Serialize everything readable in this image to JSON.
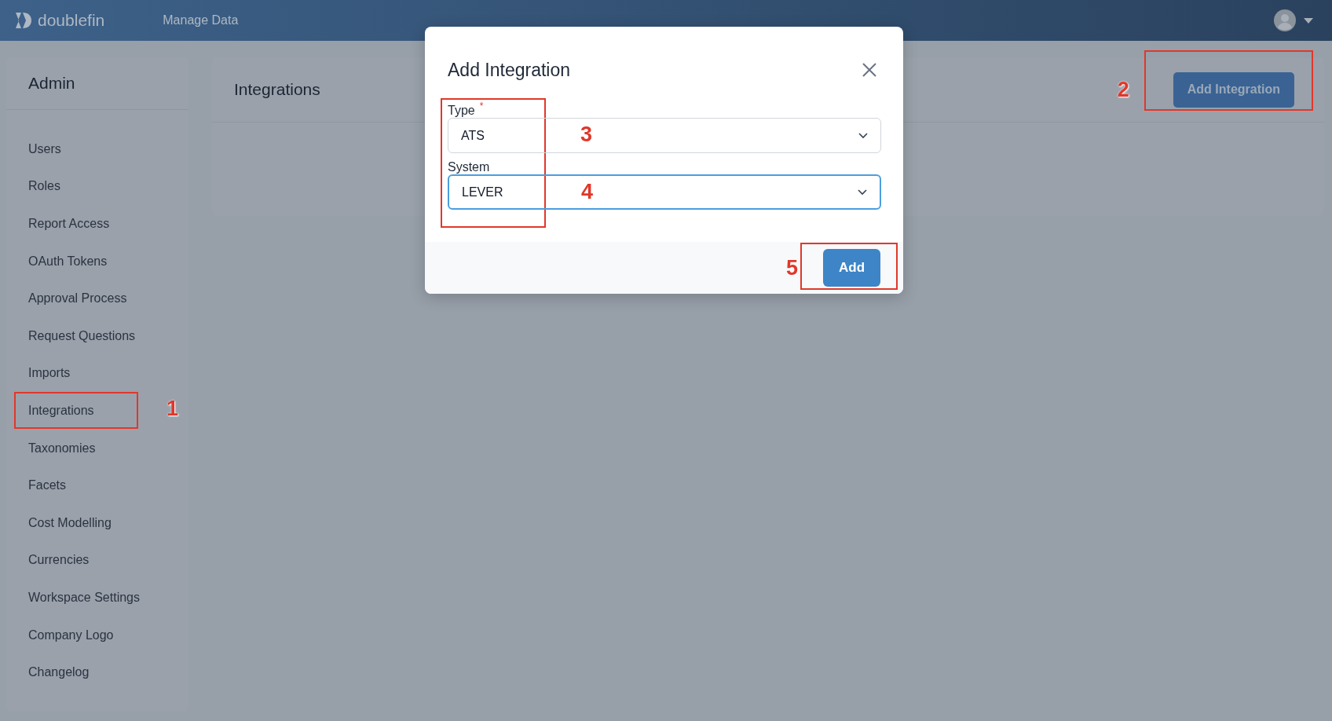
{
  "header": {
    "logo_text": "doublefin",
    "nav": "Manage Data"
  },
  "sidebar": {
    "title": "Admin",
    "items": [
      {
        "label": "Users"
      },
      {
        "label": "Roles"
      },
      {
        "label": "Report Access"
      },
      {
        "label": "OAuth Tokens"
      },
      {
        "label": "Approval Process"
      },
      {
        "label": "Request Questions"
      },
      {
        "label": "Imports"
      },
      {
        "label": "Integrations",
        "callout": "1"
      },
      {
        "label": "Taxonomies"
      },
      {
        "label": "Facets"
      },
      {
        "label": "Cost Modelling"
      },
      {
        "label": "Currencies"
      },
      {
        "label": "Workspace Settings"
      },
      {
        "label": "Company Logo"
      },
      {
        "label": "Changelog"
      }
    ]
  },
  "main": {
    "title": "Integrations",
    "button": {
      "label": "Add Integration",
      "callout": "2"
    }
  },
  "dialog": {
    "title": "Add Integration",
    "fields": [
      {
        "label": "Type",
        "required_mark": "*",
        "value": "ATS",
        "focused": false,
        "callout": "3"
      },
      {
        "label": "System",
        "value": "LEVER",
        "focused": true,
        "callout": "4"
      }
    ],
    "submit": {
      "label": "Add",
      "callout": "5"
    }
  }
}
